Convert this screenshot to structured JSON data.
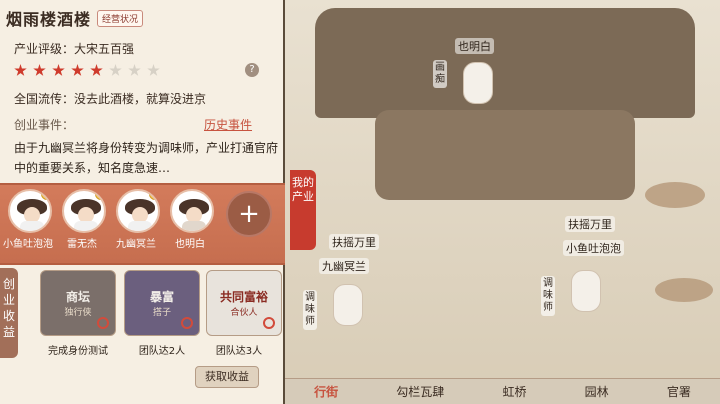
{
  "header": {
    "title": "烟雨楼酒楼",
    "badge": "经营状况"
  },
  "rating": {
    "label": "产业评级：大宋五百强",
    "stars_filled": 5,
    "stars_total": 8,
    "help": "?"
  },
  "fame": "全国流传：没去此酒楼，就算没进京",
  "events": {
    "label": "创业事件：",
    "history_link": "历史事件",
    "description": "由于九幽冥兰将身份转变为调味师，产业打通官府中的重要关系，知名度急速…"
  },
  "team": {
    "members": [
      {
        "name": "小鱼吐泡泡"
      },
      {
        "name": "雷无杰"
      },
      {
        "name": "九幽冥兰"
      },
      {
        "name": "也明白"
      }
    ],
    "add_button": "+"
  },
  "income": {
    "label": "创业收益",
    "cards": [
      {
        "title": "商坛",
        "subtitle": "独行侠",
        "caption": "完成身份测试"
      },
      {
        "title": "暴富",
        "subtitle": "搭子",
        "caption": "团队达2人"
      },
      {
        "title": "共同富裕",
        "subtitle": "合伙人",
        "caption": "团队达3人"
      }
    ],
    "collect_button": "获取收益"
  },
  "map": {
    "side_banner": "我的产业",
    "labels": [
      {
        "text": "也明白"
      },
      {
        "text": "扶摇万里"
      },
      {
        "text": "扶摇万里"
      },
      {
        "text": "九幽冥兰"
      },
      {
        "text": "小鱼吐泡泡"
      }
    ],
    "vertical_labels": [
      {
        "text": "画痴"
      },
      {
        "text": "调味师"
      },
      {
        "text": "调味师"
      }
    ],
    "bottom_nav": [
      "行街",
      "勾栏瓦肆",
      "虹桥",
      "园林",
      "官署"
    ]
  }
}
